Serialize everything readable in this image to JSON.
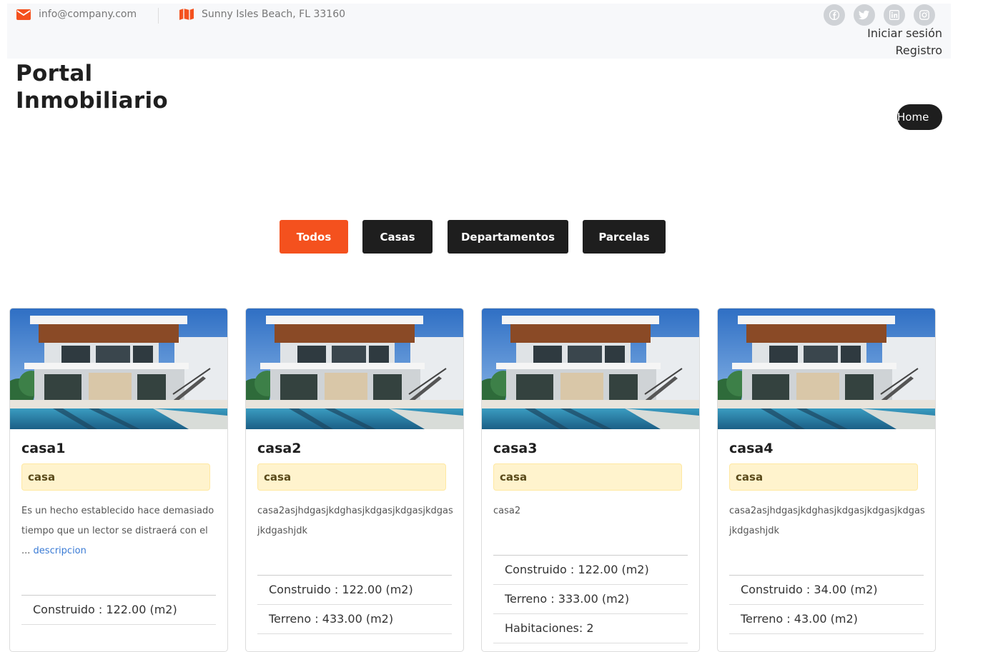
{
  "contact": {
    "email": "info@company.com",
    "address": "Sunny Isles Beach, FL 33160"
  },
  "socials": [
    "facebook-icon",
    "twitter-icon",
    "linkedin-icon",
    "instagram-icon"
  ],
  "auth": {
    "login": "Iniciar sesión",
    "register": "Registro"
  },
  "brand": {
    "line1": "Portal",
    "line2": "Inmobiliario"
  },
  "nav": {
    "home": "Home"
  },
  "filters": [
    {
      "label": "Todos",
      "active": true
    },
    {
      "label": "Casas",
      "active": false
    },
    {
      "label": "Departamentos",
      "active": false
    },
    {
      "label": "Parcelas",
      "active": false
    }
  ],
  "colors": {
    "accent": "#f4511e",
    "dark": "#1e1e1e",
    "badge_bg": "#fff3cd"
  },
  "properties": [
    {
      "title": "casa1",
      "type": "casa",
      "description": "Es un hecho establecido hace demasiado tiempo que un lector se distraerá con el ...",
      "more_link": "descripcion",
      "features": [
        "Construido : 122.00 (m2)"
      ]
    },
    {
      "title": "casa2",
      "type": "casa",
      "description": "casa2asjhdgasjkdghasjkdgasjkdgasjkdgasjkdgashjdk",
      "more_link": "",
      "features": [
        "Construido : 122.00 (m2)",
        "Terreno : 433.00 (m2)"
      ]
    },
    {
      "title": "casa3",
      "type": "casa",
      "description": "casa2",
      "more_link": "",
      "features": [
        "Construido : 122.00 (m2)",
        "Terreno : 333.00 (m2)",
        "Habitaciones: 2"
      ]
    },
    {
      "title": "casa4",
      "type": "casa",
      "description": "casa2asjhdgasjkdghasjkdgasjkdgasjkdgasjkdgashjdk",
      "more_link": "",
      "features": [
        "Construido : 34.00 (m2)",
        "Terreno : 43.00 (m2)"
      ]
    }
  ]
}
